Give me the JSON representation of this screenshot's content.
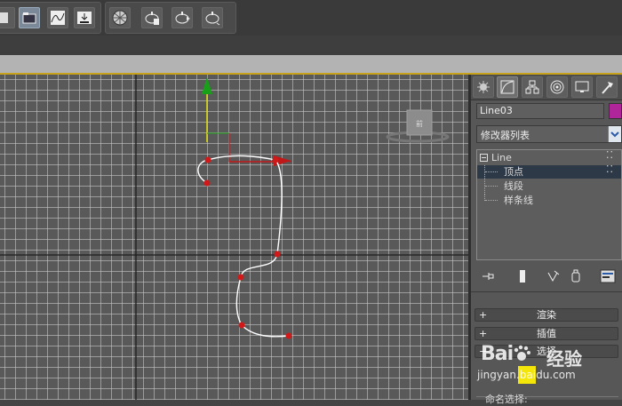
{
  "toolbar": {
    "groups": [
      {
        "icons": [
          "select-icon",
          "scene-explorer-icon",
          "curve-editor-icon",
          "render-setup-icon"
        ]
      },
      {
        "icons": [
          "material-editor-icon",
          "render-frame-icon",
          "render-production-icon",
          "render-iterative-icon"
        ]
      }
    ]
  },
  "command_panel": {
    "tabs": [
      "create-icon",
      "modify-icon",
      "hierarchy-icon",
      "motion-icon",
      "display-icon",
      "utilities-icon"
    ],
    "object_name": "Line03",
    "object_color": "#b0259a",
    "modifier_list_label": "修改器列表",
    "stack": {
      "root": "Line",
      "items": [
        "顶点",
        "线段",
        "样条线"
      ],
      "selected": "顶点"
    },
    "rollouts": [
      "渲染",
      "插值",
      "选择"
    ],
    "named_selection": "命名选择:"
  },
  "viewport": {
    "grid_color": "#d2d2d2",
    "spline_color": "#ffffff",
    "vertex_color": "#d21919",
    "vertex_count": 7
  },
  "watermark": {
    "logo": "Bai",
    "logo_cn": "经验",
    "url": "jingyan.baidu.com"
  }
}
